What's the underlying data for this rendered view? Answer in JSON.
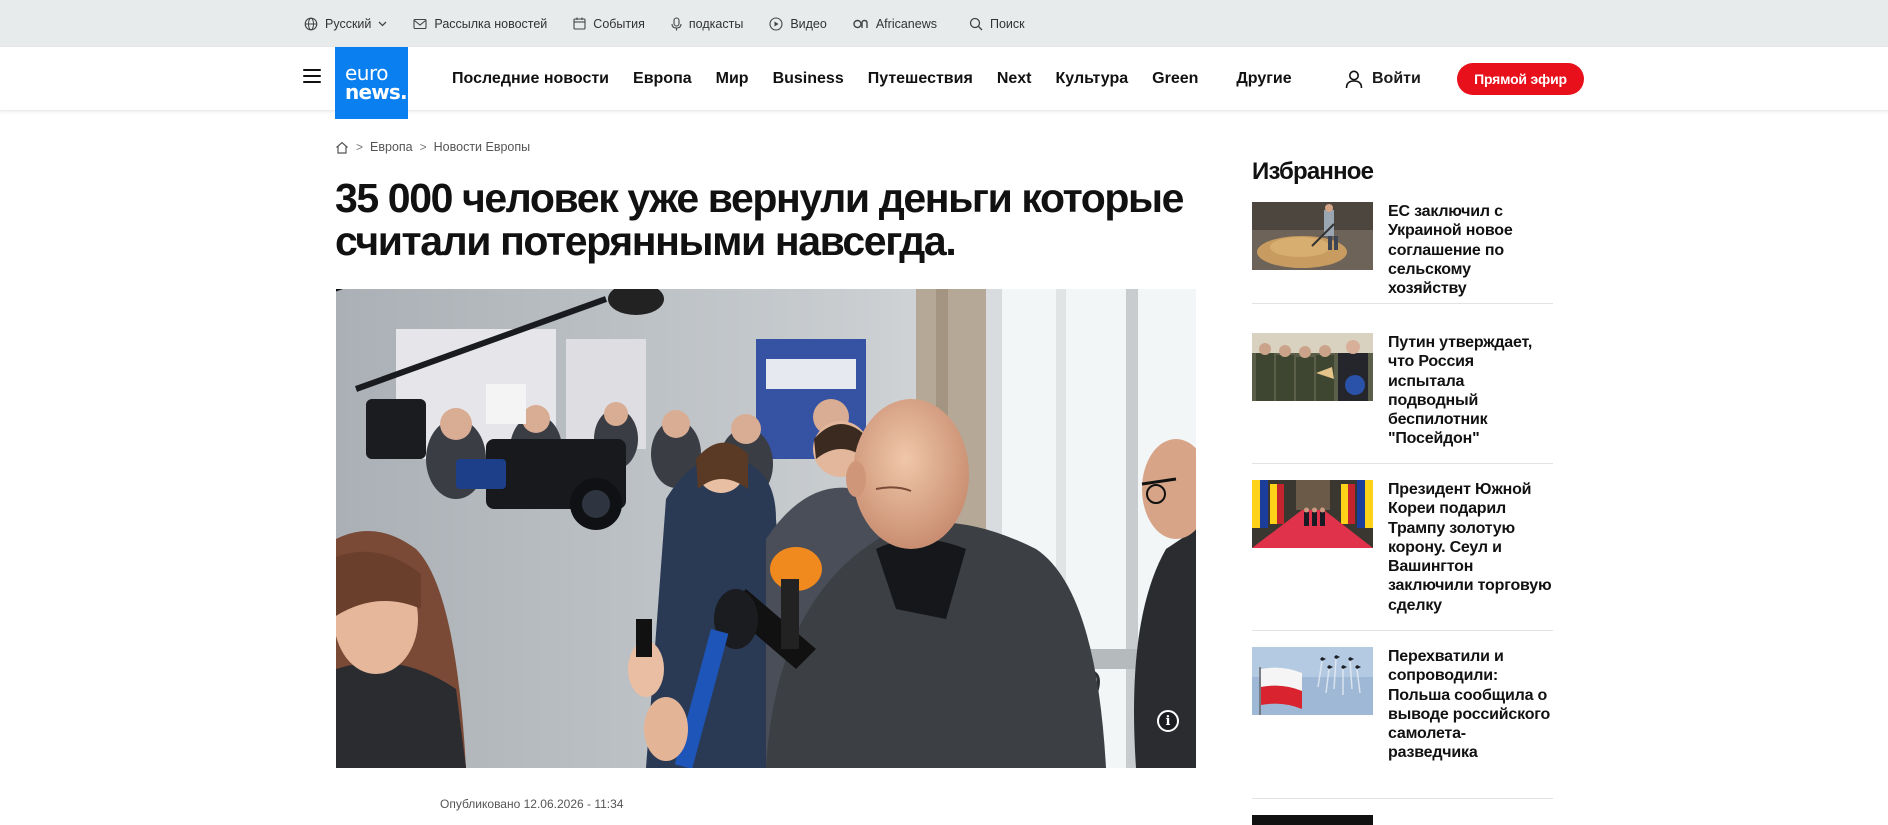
{
  "topbar": {
    "language": "Русский",
    "newsletter": "Рассылка новостей",
    "events": "События",
    "podcasts": "подкасты",
    "video": "Видео",
    "africanews": "Africanews",
    "search": "Поиск"
  },
  "header": {
    "logo_line1": "euro",
    "logo_line2": "news.",
    "nav": [
      "Последние новости",
      "Европа",
      "Мир",
      "Business",
      "Путешествия",
      "Next",
      "Культура",
      "Green"
    ],
    "more": "Другие",
    "login": "Войти",
    "live": "Прямой эфир"
  },
  "breadcrumb": [
    "Европа",
    "Новости Европы"
  ],
  "article": {
    "headline": "35 000 человек уже вернули деньги которые считали потерянными навсегда.",
    "published": "Опубликовано 12.06.2026 - 11:34",
    "info_icon": "i"
  },
  "sidebar": {
    "title": "Избранное",
    "items": [
      {
        "text": "ЕС заключил с Украиной новое соглашение по сельскому хозяйству"
      },
      {
        "text": "Путин утверждает, что Россия испытала подводный беспилотник \"Посейдон\""
      },
      {
        "text": "Президент Южной Кореи подарил Трампу золотую корону. Сеул и Вашингтон заключили торговую сделку"
      },
      {
        "text": "Перехватили и сопроводили: Польша сообщила о выводе российского самолета-разведчика"
      }
    ]
  },
  "colors": {
    "brand_blue": "#0a7ff0",
    "live_red": "#e8101a",
    "topbar_bg": "#e8ebeb"
  }
}
